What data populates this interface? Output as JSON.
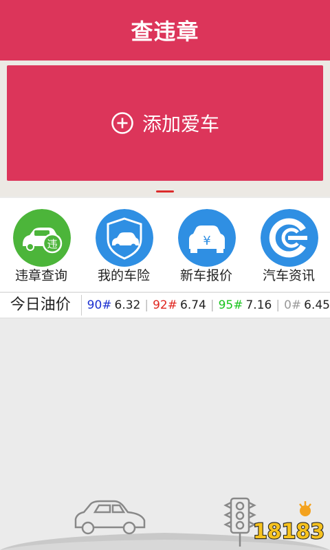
{
  "header": {
    "title": "查违章"
  },
  "banner": {
    "add_car_label": "添加爱车"
  },
  "features": [
    {
      "label": "违章查询",
      "icon": "car-violation-icon",
      "color": "#4cb53a",
      "badge": "违"
    },
    {
      "label": "我的车险",
      "icon": "car-insurance-shield-icon",
      "color": "#2f8fe3"
    },
    {
      "label": "新车报价",
      "icon": "new-car-price-icon",
      "color": "#2f8fe3",
      "badge": "¥"
    },
    {
      "label": "汽车资讯",
      "icon": "car-news-e-icon",
      "color": "#2f8fe3"
    }
  ],
  "oil": {
    "title": "今日油价",
    "items": [
      {
        "code": "90#",
        "price": "6.32",
        "color": "#1a2fd0"
      },
      {
        "code": "92#",
        "price": "6.74",
        "color": "#e0261f"
      },
      {
        "code": "95#",
        "price": "7.16",
        "color": "#19c41d"
      },
      {
        "code": "0#",
        "price": "6.45",
        "color": "#999999"
      }
    ]
  },
  "watermark": {
    "text": "18183"
  },
  "colors": {
    "brand": "#dc355a",
    "background": "#ebebeb"
  }
}
